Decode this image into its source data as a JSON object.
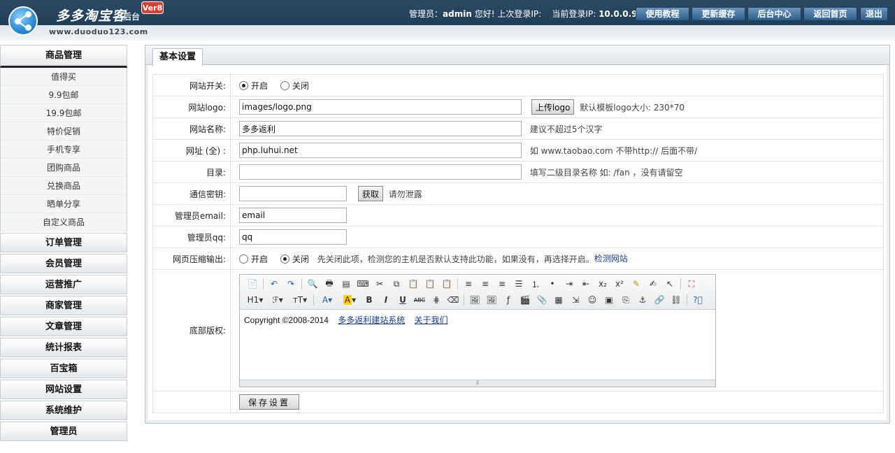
{
  "header": {
    "brand_name": "多多淘宝客",
    "brand_sub": "后台",
    "version": "Ver8",
    "url": "www.duoduo123.com",
    "admin_label": "管理员：",
    "admin_name": "admin",
    "greeting": "您好! 上次登录IP:",
    "current_ip_label": "当前登录IP:",
    "current_ip": "10.0.0.9",
    "buttons": [
      "使用教程",
      "更新缓存",
      "后台中心",
      "返回首页",
      "退出"
    ]
  },
  "sidebar": {
    "active_menu": "商品管理",
    "sub_items": [
      "值得买",
      "9.9包邮",
      "19.9包邮",
      "特价促销",
      "手机专享",
      "团购商品",
      "兑换商品",
      "晒单分享",
      "自定义商品"
    ],
    "menus": [
      "订单管理",
      "会员管理",
      "运营推广",
      "商家管理",
      "文章管理",
      "统计报表",
      "百宝箱",
      "网站设置",
      "系统维护",
      "管理员"
    ]
  },
  "tab": {
    "label": "基本设置"
  },
  "form": {
    "site_switch": {
      "label": "网站开关:",
      "on": "开启",
      "off": "关闭",
      "selected": "on"
    },
    "logo": {
      "label": "网站logo:",
      "value": "images/logo.png",
      "button": "上传logo",
      "hint": "默认模板logo大小: 230*70"
    },
    "site_name": {
      "label": "网站名称:",
      "value": "多多返利",
      "hint": "建议不超过5个汉字"
    },
    "site_url": {
      "label": "网址 (全) :",
      "value": "php.luhui.net",
      "hint": "如 www.taobao.com 不带http:// 后面不带/"
    },
    "directory": {
      "label": "目录:",
      "value": "",
      "hint": "填写二级目录名称 如: /fan ，没有请留空"
    },
    "comm_key": {
      "label": "通信密钥:",
      "value": "",
      "button": "获取",
      "hint": "请勿泄露"
    },
    "admin_email": {
      "label": "管理员email:",
      "value": "email"
    },
    "admin_qq": {
      "label": "管理员qq:",
      "value": "qq"
    },
    "gzip": {
      "label": "网页压缩输出:",
      "on": "开启",
      "off": "关闭",
      "selected": "off",
      "hint": "先关闭此项，检测您的主机是否默认支持此功能，如果没有，再选择开启。",
      "link": "检测网站"
    },
    "copyright": {
      "label": "底部版权:",
      "text": "Copyright ©2008-2014",
      "link1": "多多返利建站系统",
      "link2": "关于我们",
      "toolbar_row2_text": {
        "heading": "H1",
        "font": "ℱ",
        "size": "тT",
        "bold": "B",
        "italic": "I",
        "underline": "U",
        "strike": "ABC"
      }
    },
    "save_button": "保存设置"
  }
}
